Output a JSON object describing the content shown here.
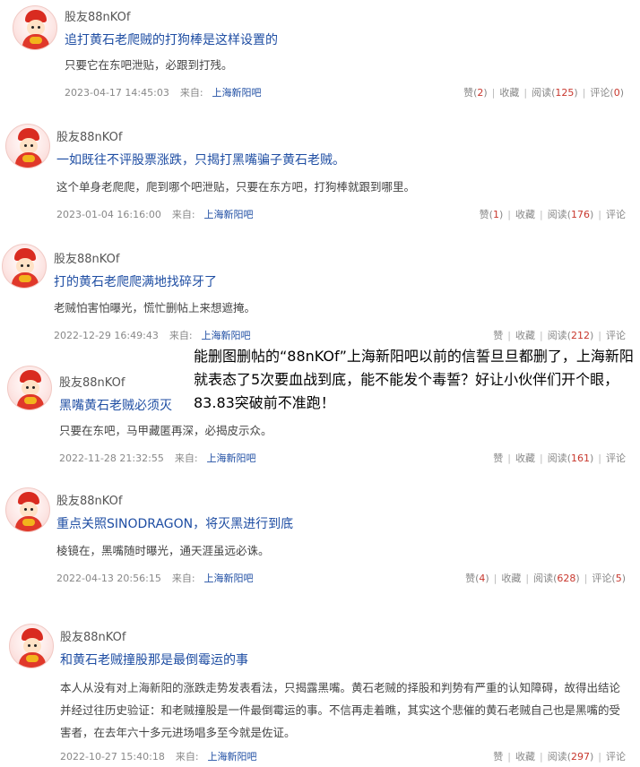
{
  "posts": [
    {
      "author": "股友88nKOf",
      "title": "追打黄石老爬贼的打狗棒是这样设置的",
      "content": "只要它在东吧泄贴，必跟到打残。",
      "time": "2023-04-17 14:45:03",
      "from_label": "来自:",
      "source": "上海新阳吧",
      "like_label": "赞",
      "like_count": "2",
      "collect_label": "收藏",
      "read_label": "阅读",
      "read_count": "125",
      "comment_label": "评论",
      "comment_count": "0"
    },
    {
      "author": "股友88nKOf",
      "title": "一如既往不评股票涨跌，只揭打黑嘴骗子黄石老贼。",
      "content": "这个单身老爬爬，爬到哪个吧泄贴，只要在东方吧，打狗棒就跟到哪里。",
      "time": "2023-01-04 16:16:00",
      "from_label": "来自:",
      "source": "上海新阳吧",
      "like_label": "赞",
      "like_count": "1",
      "collect_label": "收藏",
      "read_label": "阅读",
      "read_count": "176",
      "comment_label": "评论",
      "comment_count": ""
    },
    {
      "author": "股友88nKOf",
      "title": "打的黄石老爬爬满地找碎牙了",
      "content": "老贼怕害怕曝光，慌忙删帖上来想遮掩。",
      "time": "2022-12-29 16:49:43",
      "from_label": "来自:",
      "source": "上海新阳吧",
      "like_label": "赞",
      "like_count": "",
      "collect_label": "收藏",
      "read_label": "阅读",
      "read_count": "212",
      "comment_label": "评论",
      "comment_count": ""
    },
    {
      "author": "股友88nKOf",
      "title": "黑嘴黄石老贼必须灭",
      "content": "只要在东吧，马甲藏匿再深，必揭皮示众。",
      "time": "2022-11-28 21:32:55",
      "from_label": "来自:",
      "source": "上海新阳吧",
      "like_label": "赞",
      "like_count": "",
      "collect_label": "收藏",
      "read_label": "阅读",
      "read_count": "161",
      "comment_label": "评论",
      "comment_count": ""
    },
    {
      "author": "股友88nKOf",
      "title": "重点关照SINODRAGON，将灭黑进行到底",
      "content": "棱镜在，黑嘴随时曝光，通天涯虽远必诛。",
      "time": "2022-04-13 20:56:15",
      "from_label": "来自:",
      "source": "上海新阳吧",
      "like_label": "赞",
      "like_count": "4",
      "collect_label": "收藏",
      "read_label": "阅读",
      "read_count": "628",
      "comment_label": "评论",
      "comment_count": "5"
    },
    {
      "author": "股友88nKOf",
      "title": "和黄石老贼撞股那是最倒霉运的事",
      "content": "本人从没有对上海新阳的涨跌走势发表看法，只揭露黑嘴。黄石老贼的择股和判势有严重的认知障碍，故得出结论并经过往历史验证：和老贼撞股是一件最倒霉运的事。不信再走着瞧，其实这个悲催的黄石老贼自己也是黑嘴的受害者，在去年六十多元进场唱多至今就是佐证。",
      "time": "2022-10-27 15:40:18",
      "from_label": "来自:",
      "source": "上海新阳吧",
      "like_label": "赞",
      "like_count": "",
      "collect_label": "收藏",
      "read_label": "阅读",
      "read_count": "297",
      "comment_label": "评论",
      "comment_count": ""
    }
  ],
  "overlay_text": "能删图删帖的“88nKOf”上海新阳吧以前的信誓旦旦都删了，上海新阳就表态了5次要血战到底，能不能发个毒誓？好让小伙伴们开个眼，83.83突破前不准跑！"
}
